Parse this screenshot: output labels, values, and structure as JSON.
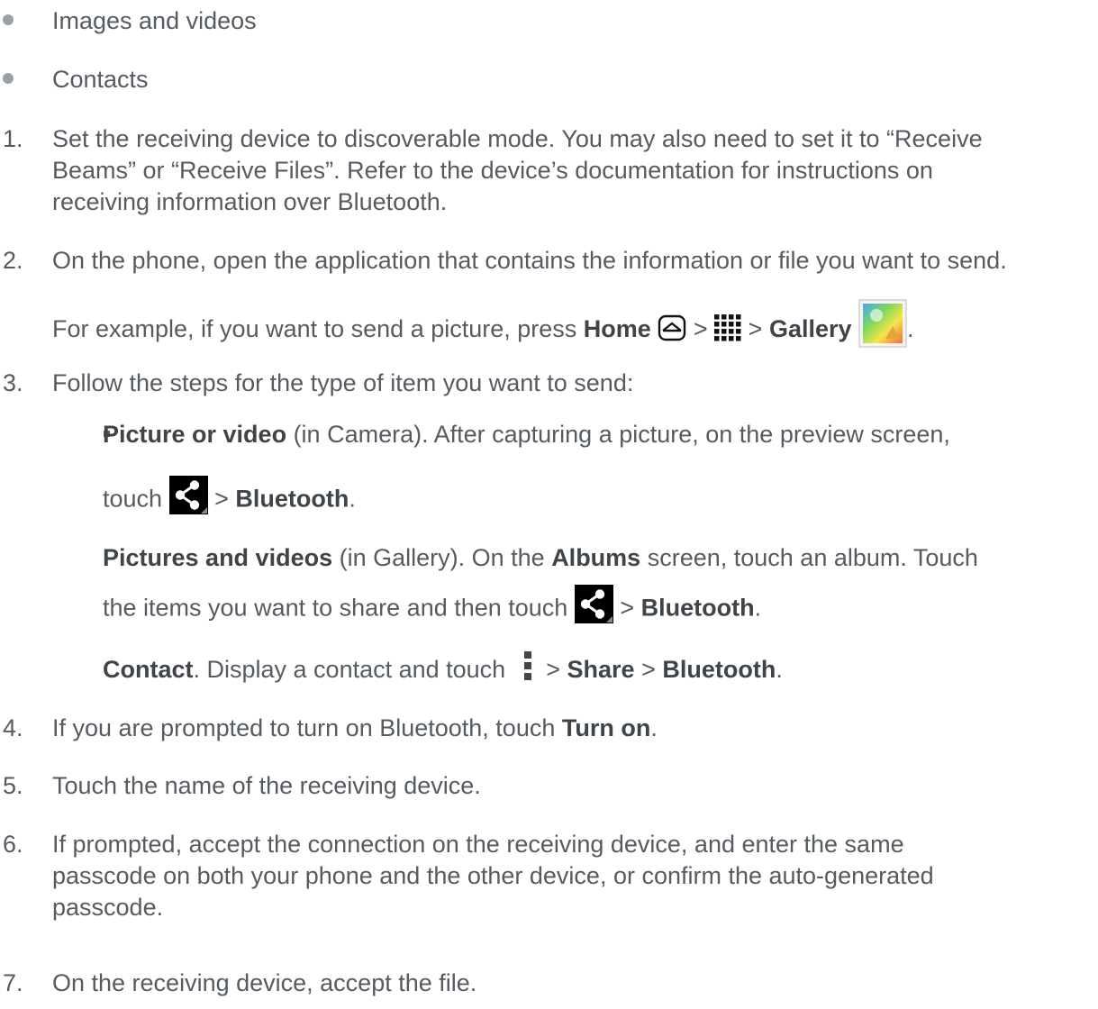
{
  "bullets": [
    {
      "text": "Images and videos"
    },
    {
      "text": "Contacts"
    }
  ],
  "steps": [
    {
      "num": "1.",
      "lines": [
        "Set the receiving device to discoverable mode. You may also need to set it to “Receive",
        "Beams” or “Receive Files”. Refer to the device’s documentation for instructions on",
        "receiving information over Bluetooth."
      ]
    },
    {
      "num": "2.",
      "line1": "On the phone, open the application that contains the information or file you want to send.",
      "line2_prefix": "For example, if you want to send a picture, press ",
      "home": "Home",
      "sep": ">",
      "gallery": "Gallery",
      "end": "."
    },
    {
      "num": "3.",
      "text": "Follow the steps for the type of item you want to send:"
    },
    {
      "num": "4.",
      "text": "If you are prompted to turn on Bluetooth, touch ",
      "bold": "Turn on",
      "end": "."
    },
    {
      "num": "5.",
      "text": "Touch the name of the receiving device."
    },
    {
      "num": "6.",
      "lines": [
        "If prompted, accept the connection on the receiving device, and enter the same",
        "passcode on both your phone and the other device, or confirm the auto-generated",
        "passcode."
      ]
    },
    {
      "num": "7.",
      "text": "On the receiving device, accept the file."
    }
  ],
  "substeps": [
    {
      "bold": "Picture or video",
      "text": " (in Camera). After capturing a picture, on the preview screen,",
      "line2_prefix": "touch",
      "sep": ">",
      "target": "Bluetooth",
      "end": "."
    },
    {
      "bold": "Pictures and videos",
      "text": " (in Gallery). On the ",
      "bold2": "Albums",
      "text2": " screen, touch an album. Touch",
      "line2_prefix": "the items you want to share and then touch ",
      "sep": ">",
      "target": "Bluetooth",
      "end": "."
    },
    {
      "bold": "Contact",
      "text": ". Display a contact and touch ",
      "sep": ">",
      "share": "Share",
      "sep2": ">",
      "target": "Bluetooth",
      "end": "."
    }
  ],
  "icons": {
    "home": "home-icon",
    "apps": "apps-grid-icon",
    "gallery": "gallery-icon",
    "share": "share-icon",
    "menu": "menu-icon"
  },
  "colors": {
    "text": "#555b60",
    "bold": "#3f4449",
    "icon_dark": "#111111"
  }
}
